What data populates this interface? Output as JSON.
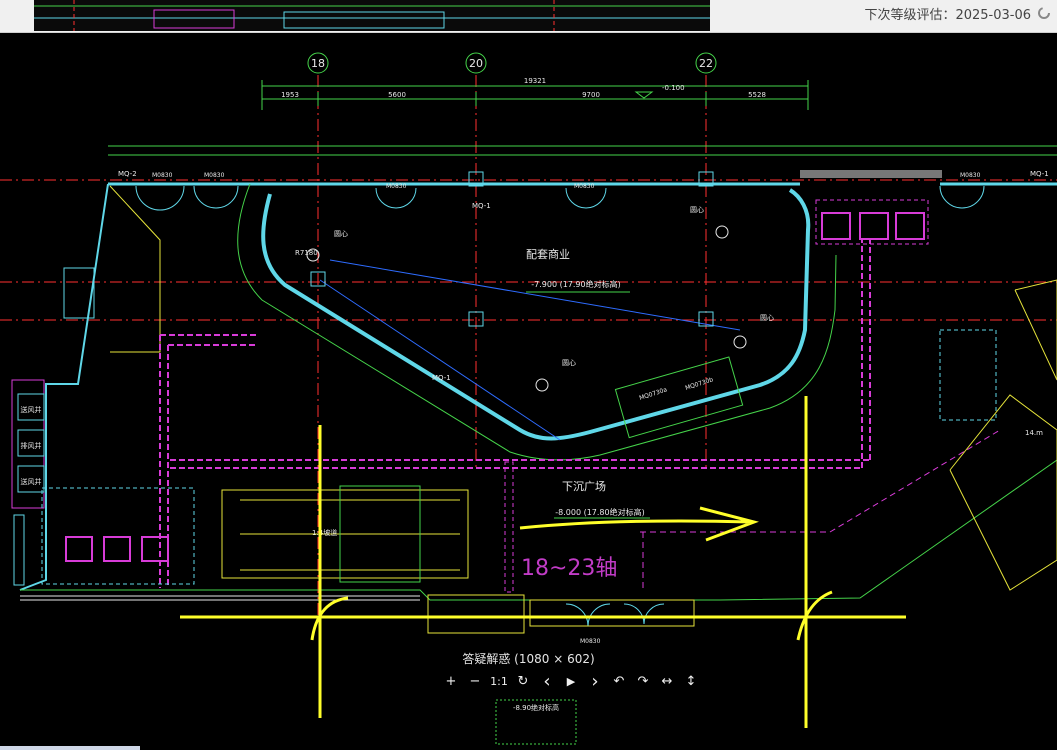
{
  "header": {
    "status_text": "下次等级评估：2025-03-06"
  },
  "drawing": {
    "grid_axes": [
      "18",
      "20",
      "22"
    ],
    "total_dimension": "19321",
    "dimension_segments": [
      "1953",
      "5600",
      "9700",
      "5528"
    ],
    "level_tag_top": "-0.100",
    "room_label": "配套商业",
    "room_elevation": "-7.900 (17.90绝对标高)",
    "plaza_label": "下沉广场",
    "plaza_elevation": "-8.000 (17.80绝对标高)",
    "wall_tags": [
      "MQ-2",
      "MQ-1",
      "MQ-1",
      "MQ-1"
    ],
    "door_tags": [
      "M0830",
      "M0830",
      "M0830",
      "M0830",
      "M0830",
      "M0830"
    ],
    "door_tags_lower": [
      "MQ0730a",
      "MQ0730b"
    ],
    "column_note": "圆心",
    "radius_label": "R7180",
    "annotation_axes": "18~23轴",
    "stair_note": "1:4坡道",
    "side_room_labels": [
      "送风井",
      "排风井",
      "送风井"
    ],
    "right_label": "14.m",
    "bottom_tag": "-8.90绝对标高"
  },
  "viewer": {
    "caption": "答疑解惑 (1080 × 602)"
  },
  "toolbar": {
    "zoom_in": "+",
    "zoom_out": "−",
    "actual_size": "1:1",
    "refresh": "↻",
    "prev": "‹",
    "play": "▶",
    "next": "›",
    "rotate_left": "↶",
    "rotate_right": "↷",
    "fit_width": "↔",
    "fit_height": "↕"
  },
  "colors": {
    "wall_cyan": "#5fd7e8",
    "grid_red": "#ff3030",
    "line_green": "#45d34a",
    "hatch_magenta": "#d83cd8",
    "stair_yellow": "#e6e43a",
    "annotation_purple": "#c23cc7",
    "marker_yellow": "#ffff2a",
    "text_white": "#e8e8e8"
  }
}
